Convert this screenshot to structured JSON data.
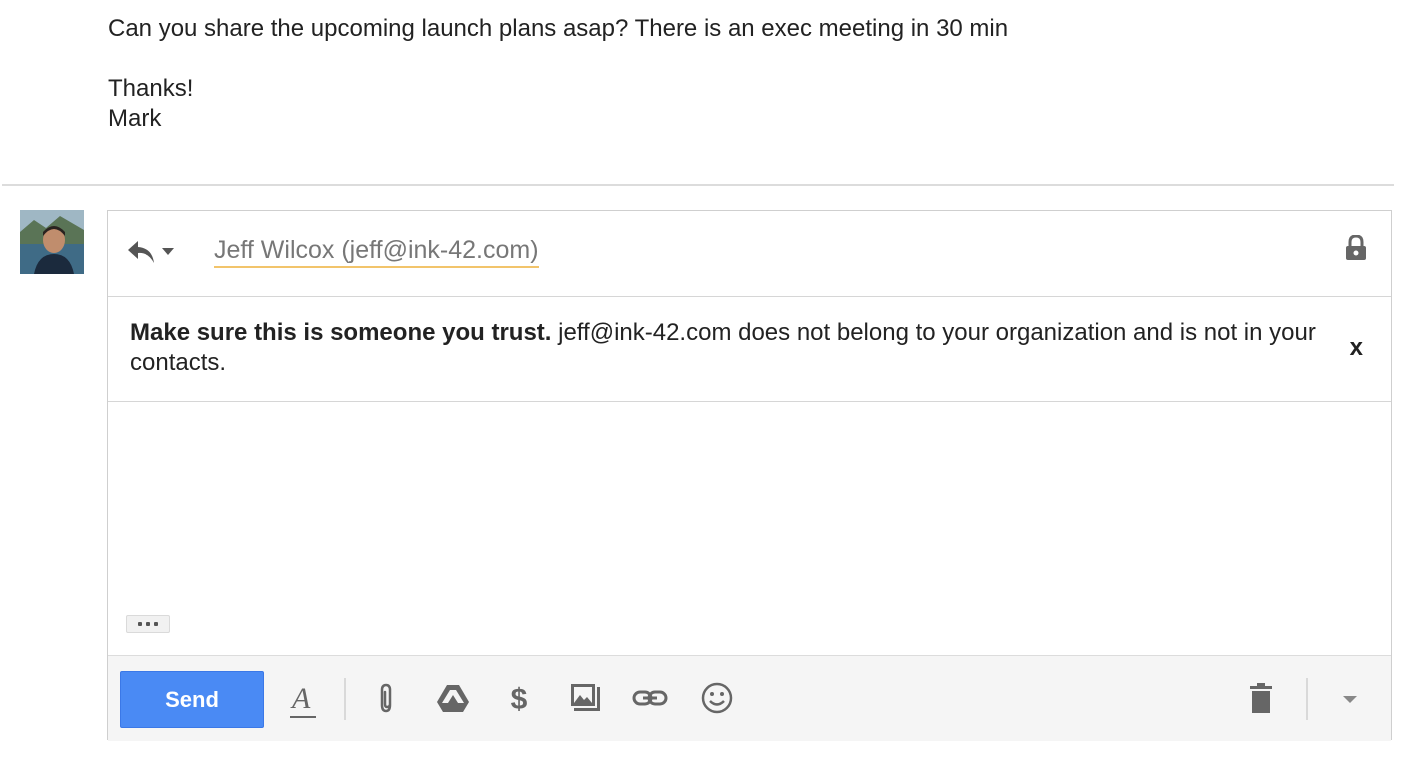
{
  "previous_message": {
    "line1": "Can you share the upcoming launch plans asap? There is an exec meeting in 30 min",
    "line2": "Thanks!",
    "line3": "Mark"
  },
  "compose": {
    "recipient": "Jeff Wilcox (jeff@ink-42.com)",
    "warning_bold": "Make sure this is someone you trust.",
    "warning_rest": " jeff@ink-42.com does not belong to your organization and is not in your contacts.",
    "warning_close": "x",
    "send_label": "Send"
  },
  "icons": [
    "reply-icon",
    "lock-icon",
    "formatting-icon",
    "attach-icon",
    "drive-icon",
    "money-icon",
    "photo-icon",
    "link-icon",
    "emoji-icon",
    "trash-icon",
    "more-options-icon"
  ],
  "colors": {
    "send": "#4a8af4",
    "recipient_underline": "#f2c46b",
    "toolbar_bg": "#f5f5f5"
  }
}
